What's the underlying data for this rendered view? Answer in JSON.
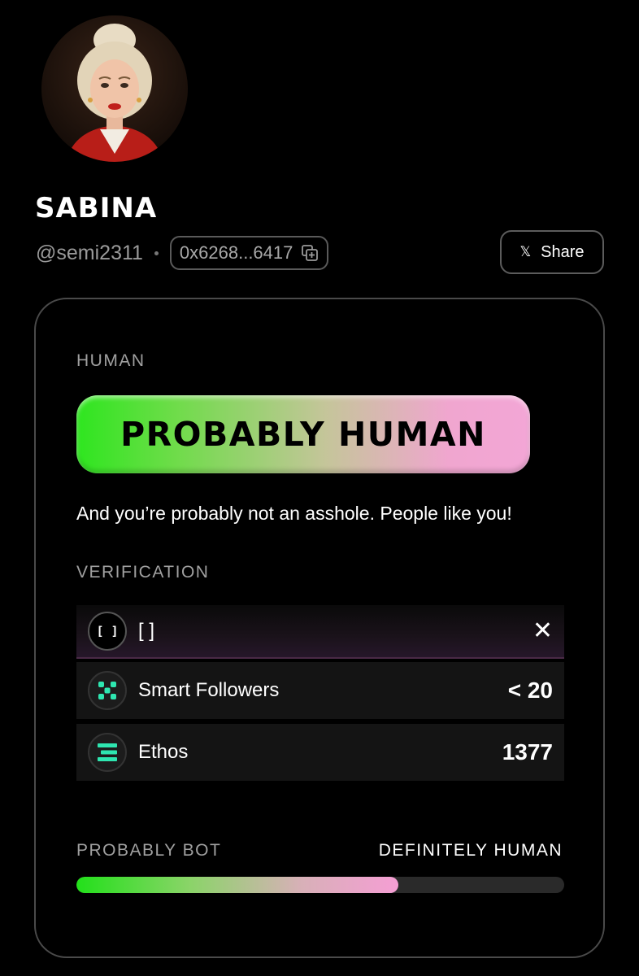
{
  "profile": {
    "name": "SABINA",
    "handle": "@semi2311",
    "wallet": "0x6268...6417"
  },
  "header": {
    "share_label": "Share",
    "share_icon": "x-logo-icon"
  },
  "card": {
    "section_human": "HUMAN",
    "verdict": "PROBABLY HUMAN",
    "description": "And you’re probably not an asshole. People like you!",
    "section_verification": "VERIFICATION",
    "verifications": [
      {
        "icon": "bracket-icon",
        "icon_text": "[ ]",
        "label": "[ ]",
        "value": ""
      },
      {
        "icon": "smart-followers-icon",
        "label": "Smart Followers",
        "value": "< 20"
      },
      {
        "icon": "ethos-icon",
        "label": "Ethos",
        "value": "1377"
      }
    ],
    "scale_left": "PROBABLY BOT",
    "scale_right": "DEFINITELY HUMAN",
    "human_score_fraction": 0.66
  },
  "colors": {
    "accent_green": "#2ee61f",
    "accent_pink": "#f3a6d6",
    "icon_teal": "#2ee6b0"
  }
}
